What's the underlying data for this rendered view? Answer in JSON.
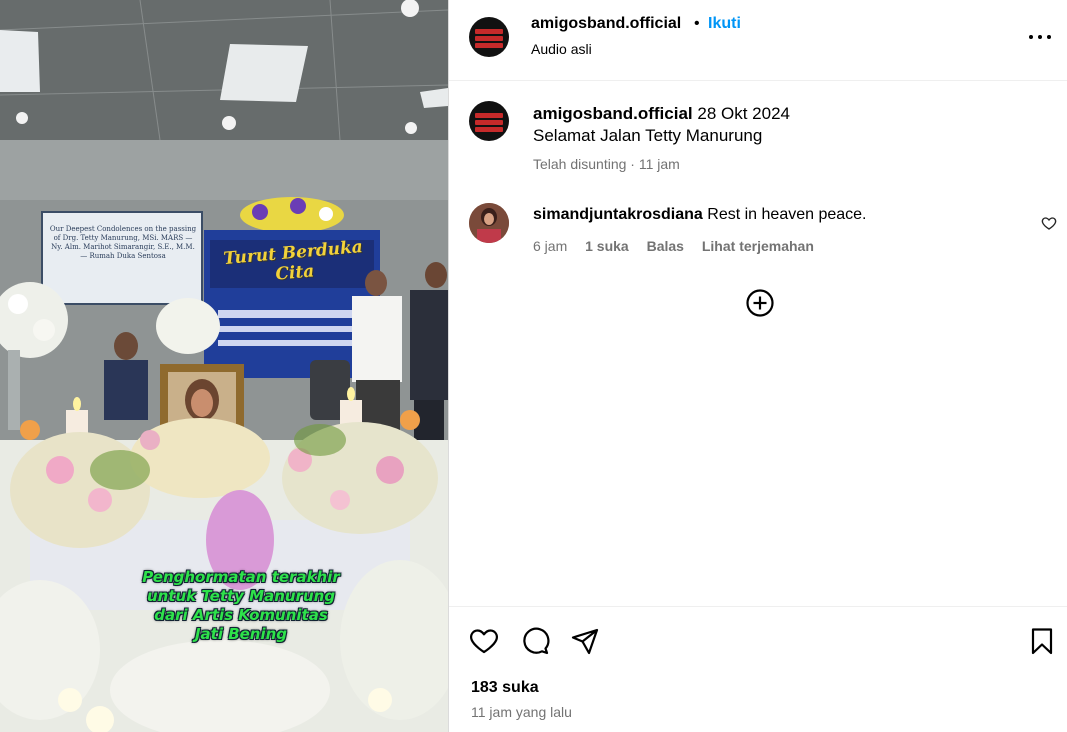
{
  "post": {
    "username": "amigosband.official",
    "separator": "•",
    "follow_label": "Ikuti",
    "audio_label": "Audio asli",
    "more_icon": "more-horizontal-icon"
  },
  "media": {
    "screen_text": "Our Deepest Condolences on the passing of Drg. Tetty Manurung, MSi. MARS — Ny. Alm. Marihot Simarangir, S.E., M.M. — Rumah Duka Sentosa",
    "banner_text": "Turut Berduka Cita",
    "overlay_lines": [
      "Penghormatan terakhir",
      "untuk Tetty Manurung",
      "dari Artis Komunitas",
      "Jati Bening"
    ]
  },
  "caption": {
    "username": "amigosband.official",
    "date": "28 Okt 2024",
    "text": "Selamat Jalan Tetty Manurung",
    "edited": "Telah disunting · 11 jam"
  },
  "comment": {
    "username": "simandjuntakrosdiana",
    "text": "Rest in heaven peace.",
    "time": "6 jam",
    "likes": "1 suka",
    "reply": "Balas",
    "translate": "Lihat terjemahan"
  },
  "actions": {
    "like_icon": "heart-icon",
    "comment_icon": "comment-icon",
    "share_icon": "share-icon",
    "save_icon": "bookmark-icon",
    "add_comment_icon": "plus-circle-icon"
  },
  "footer": {
    "likes": "183 suka",
    "time": "11 jam yang lalu"
  },
  "colors": {
    "accent": "#0095f6",
    "muted": "#737373",
    "caption_green": "#2ee24a"
  }
}
